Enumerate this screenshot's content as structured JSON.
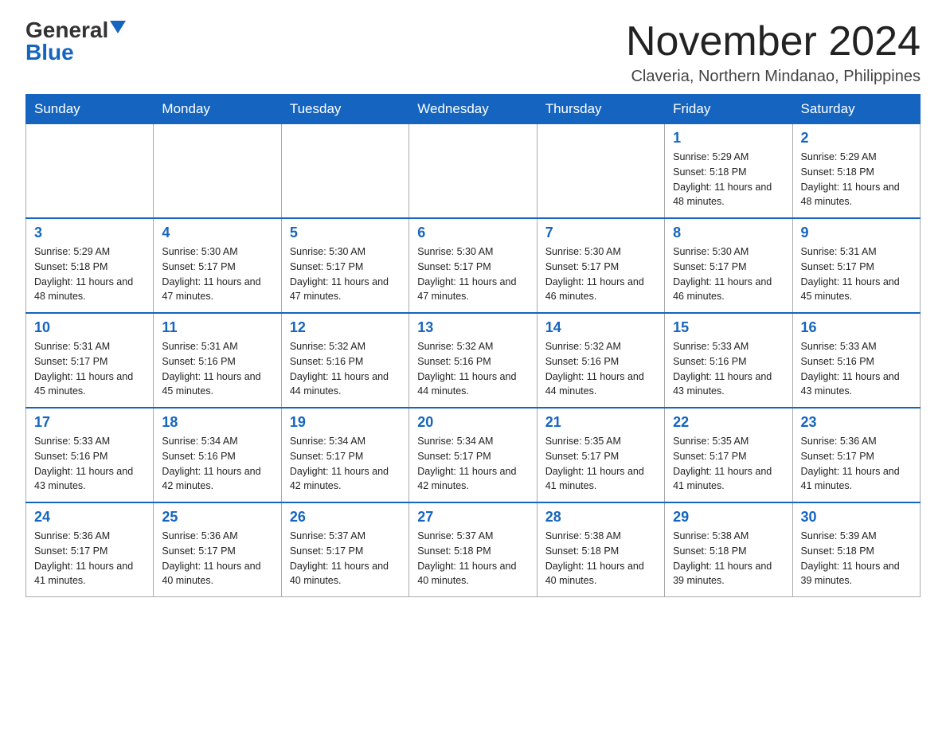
{
  "logo": {
    "general": "General",
    "blue": "Blue"
  },
  "title": "November 2024",
  "subtitle": "Claveria, Northern Mindanao, Philippines",
  "weekdays": [
    "Sunday",
    "Monday",
    "Tuesday",
    "Wednesday",
    "Thursday",
    "Friday",
    "Saturday"
  ],
  "weeks": [
    [
      null,
      null,
      null,
      null,
      null,
      {
        "day": "1",
        "sunrise": "Sunrise: 5:29 AM",
        "sunset": "Sunset: 5:18 PM",
        "daylight": "Daylight: 11 hours and 48 minutes."
      },
      {
        "day": "2",
        "sunrise": "Sunrise: 5:29 AM",
        "sunset": "Sunset: 5:18 PM",
        "daylight": "Daylight: 11 hours and 48 minutes."
      }
    ],
    [
      {
        "day": "3",
        "sunrise": "Sunrise: 5:29 AM",
        "sunset": "Sunset: 5:18 PM",
        "daylight": "Daylight: 11 hours and 48 minutes."
      },
      {
        "day": "4",
        "sunrise": "Sunrise: 5:30 AM",
        "sunset": "Sunset: 5:17 PM",
        "daylight": "Daylight: 11 hours and 47 minutes."
      },
      {
        "day": "5",
        "sunrise": "Sunrise: 5:30 AM",
        "sunset": "Sunset: 5:17 PM",
        "daylight": "Daylight: 11 hours and 47 minutes."
      },
      {
        "day": "6",
        "sunrise": "Sunrise: 5:30 AM",
        "sunset": "Sunset: 5:17 PM",
        "daylight": "Daylight: 11 hours and 47 minutes."
      },
      {
        "day": "7",
        "sunrise": "Sunrise: 5:30 AM",
        "sunset": "Sunset: 5:17 PM",
        "daylight": "Daylight: 11 hours and 46 minutes."
      },
      {
        "day": "8",
        "sunrise": "Sunrise: 5:30 AM",
        "sunset": "Sunset: 5:17 PM",
        "daylight": "Daylight: 11 hours and 46 minutes."
      },
      {
        "day": "9",
        "sunrise": "Sunrise: 5:31 AM",
        "sunset": "Sunset: 5:17 PM",
        "daylight": "Daylight: 11 hours and 45 minutes."
      }
    ],
    [
      {
        "day": "10",
        "sunrise": "Sunrise: 5:31 AM",
        "sunset": "Sunset: 5:17 PM",
        "daylight": "Daylight: 11 hours and 45 minutes."
      },
      {
        "day": "11",
        "sunrise": "Sunrise: 5:31 AM",
        "sunset": "Sunset: 5:16 PM",
        "daylight": "Daylight: 11 hours and 45 minutes."
      },
      {
        "day": "12",
        "sunrise": "Sunrise: 5:32 AM",
        "sunset": "Sunset: 5:16 PM",
        "daylight": "Daylight: 11 hours and 44 minutes."
      },
      {
        "day": "13",
        "sunrise": "Sunrise: 5:32 AM",
        "sunset": "Sunset: 5:16 PM",
        "daylight": "Daylight: 11 hours and 44 minutes."
      },
      {
        "day": "14",
        "sunrise": "Sunrise: 5:32 AM",
        "sunset": "Sunset: 5:16 PM",
        "daylight": "Daylight: 11 hours and 44 minutes."
      },
      {
        "day": "15",
        "sunrise": "Sunrise: 5:33 AM",
        "sunset": "Sunset: 5:16 PM",
        "daylight": "Daylight: 11 hours and 43 minutes."
      },
      {
        "day": "16",
        "sunrise": "Sunrise: 5:33 AM",
        "sunset": "Sunset: 5:16 PM",
        "daylight": "Daylight: 11 hours and 43 minutes."
      }
    ],
    [
      {
        "day": "17",
        "sunrise": "Sunrise: 5:33 AM",
        "sunset": "Sunset: 5:16 PM",
        "daylight": "Daylight: 11 hours and 43 minutes."
      },
      {
        "day": "18",
        "sunrise": "Sunrise: 5:34 AM",
        "sunset": "Sunset: 5:16 PM",
        "daylight": "Daylight: 11 hours and 42 minutes."
      },
      {
        "day": "19",
        "sunrise": "Sunrise: 5:34 AM",
        "sunset": "Sunset: 5:17 PM",
        "daylight": "Daylight: 11 hours and 42 minutes."
      },
      {
        "day": "20",
        "sunrise": "Sunrise: 5:34 AM",
        "sunset": "Sunset: 5:17 PM",
        "daylight": "Daylight: 11 hours and 42 minutes."
      },
      {
        "day": "21",
        "sunrise": "Sunrise: 5:35 AM",
        "sunset": "Sunset: 5:17 PM",
        "daylight": "Daylight: 11 hours and 41 minutes."
      },
      {
        "day": "22",
        "sunrise": "Sunrise: 5:35 AM",
        "sunset": "Sunset: 5:17 PM",
        "daylight": "Daylight: 11 hours and 41 minutes."
      },
      {
        "day": "23",
        "sunrise": "Sunrise: 5:36 AM",
        "sunset": "Sunset: 5:17 PM",
        "daylight": "Daylight: 11 hours and 41 minutes."
      }
    ],
    [
      {
        "day": "24",
        "sunrise": "Sunrise: 5:36 AM",
        "sunset": "Sunset: 5:17 PM",
        "daylight": "Daylight: 11 hours and 41 minutes."
      },
      {
        "day": "25",
        "sunrise": "Sunrise: 5:36 AM",
        "sunset": "Sunset: 5:17 PM",
        "daylight": "Daylight: 11 hours and 40 minutes."
      },
      {
        "day": "26",
        "sunrise": "Sunrise: 5:37 AM",
        "sunset": "Sunset: 5:17 PM",
        "daylight": "Daylight: 11 hours and 40 minutes."
      },
      {
        "day": "27",
        "sunrise": "Sunrise: 5:37 AM",
        "sunset": "Sunset: 5:18 PM",
        "daylight": "Daylight: 11 hours and 40 minutes."
      },
      {
        "day": "28",
        "sunrise": "Sunrise: 5:38 AM",
        "sunset": "Sunset: 5:18 PM",
        "daylight": "Daylight: 11 hours and 40 minutes."
      },
      {
        "day": "29",
        "sunrise": "Sunrise: 5:38 AM",
        "sunset": "Sunset: 5:18 PM",
        "daylight": "Daylight: 11 hours and 39 minutes."
      },
      {
        "day": "30",
        "sunrise": "Sunrise: 5:39 AM",
        "sunset": "Sunset: 5:18 PM",
        "daylight": "Daylight: 11 hours and 39 minutes."
      }
    ]
  ]
}
